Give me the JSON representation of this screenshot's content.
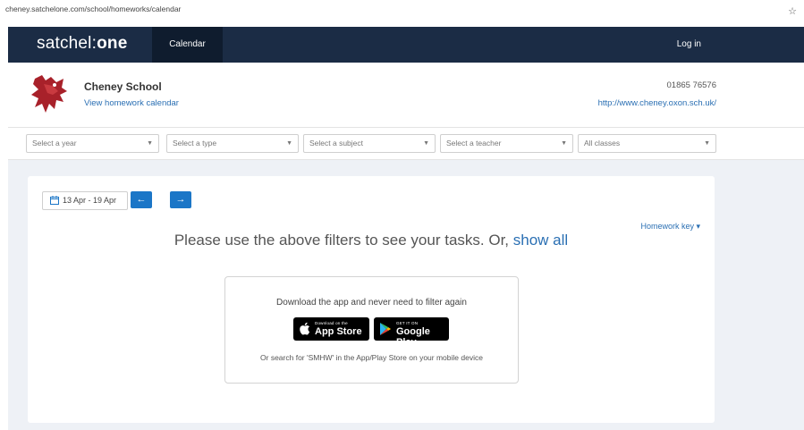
{
  "browser": {
    "url": "cheney.satchelone.com/school/homeworks/calendar",
    "star_icon": "star-icon"
  },
  "nav": {
    "brand_prefix": "satchel:",
    "brand_suffix": "one",
    "tab_calendar": "Calendar",
    "login": "Log in",
    "bg_color": "#1b2c45"
  },
  "school": {
    "name": "Cheney School",
    "calendar_link": "View homework calendar",
    "phone": "01865 76576",
    "website": "http://www.cheney.oxon.sch.uk/",
    "logo_icon": "school-crest-icon"
  },
  "filters": {
    "year": "Select a year",
    "type": "Select a type",
    "subject": "Select a subject",
    "teacher": "Select a teacher",
    "classes": "All classes"
  },
  "calendar": {
    "date_range": "13 Apr - 19 Apr",
    "prev_icon": "arrow-left-icon",
    "next_icon": "arrow-right-icon",
    "homework_key": "Homework key ▾",
    "message": "Please use the above filters to see your tasks. Or, ",
    "show_all": "show all"
  },
  "app_promo": {
    "headline": "Download the app and never need to filter again",
    "appstore_small": "Download on the",
    "appstore_big": "App Store",
    "gplay_small": "GET IT ON",
    "gplay_big": "Google Play",
    "footer": "Or search for 'SMHW' in the App/Play Store on your mobile device"
  },
  "colors": {
    "accent_blue": "#1b76c7",
    "link_blue": "#2a6fb3",
    "page_bg": "#eef1f6"
  }
}
